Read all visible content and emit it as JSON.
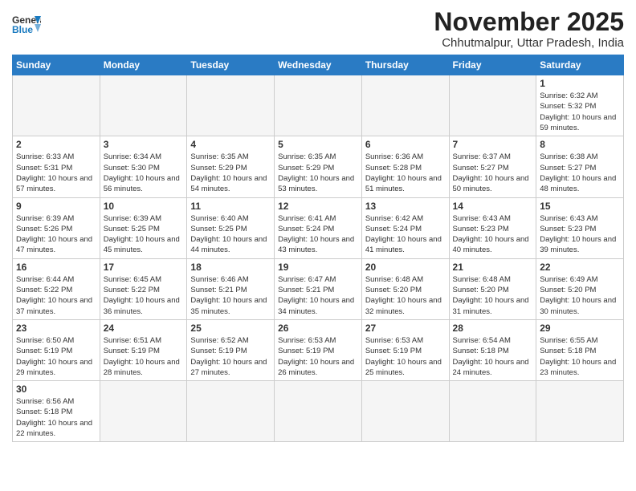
{
  "header": {
    "logo_general": "General",
    "logo_blue": "Blue",
    "month": "November 2025",
    "location": "Chhutmalpur, Uttar Pradesh, India"
  },
  "weekdays": [
    "Sunday",
    "Monday",
    "Tuesday",
    "Wednesday",
    "Thursday",
    "Friday",
    "Saturday"
  ],
  "days": {
    "1": {
      "sunrise": "6:32 AM",
      "sunset": "5:32 PM",
      "daylight": "10 hours and 59 minutes."
    },
    "2": {
      "sunrise": "6:33 AM",
      "sunset": "5:31 PM",
      "daylight": "10 hours and 57 minutes."
    },
    "3": {
      "sunrise": "6:34 AM",
      "sunset": "5:30 PM",
      "daylight": "10 hours and 56 minutes."
    },
    "4": {
      "sunrise": "6:35 AM",
      "sunset": "5:29 PM",
      "daylight": "10 hours and 54 minutes."
    },
    "5": {
      "sunrise": "6:35 AM",
      "sunset": "5:29 PM",
      "daylight": "10 hours and 53 minutes."
    },
    "6": {
      "sunrise": "6:36 AM",
      "sunset": "5:28 PM",
      "daylight": "10 hours and 51 minutes."
    },
    "7": {
      "sunrise": "6:37 AM",
      "sunset": "5:27 PM",
      "daylight": "10 hours and 50 minutes."
    },
    "8": {
      "sunrise": "6:38 AM",
      "sunset": "5:27 PM",
      "daylight": "10 hours and 48 minutes."
    },
    "9": {
      "sunrise": "6:39 AM",
      "sunset": "5:26 PM",
      "daylight": "10 hours and 47 minutes."
    },
    "10": {
      "sunrise": "6:39 AM",
      "sunset": "5:25 PM",
      "daylight": "10 hours and 45 minutes."
    },
    "11": {
      "sunrise": "6:40 AM",
      "sunset": "5:25 PM",
      "daylight": "10 hours and 44 minutes."
    },
    "12": {
      "sunrise": "6:41 AM",
      "sunset": "5:24 PM",
      "daylight": "10 hours and 43 minutes."
    },
    "13": {
      "sunrise": "6:42 AM",
      "sunset": "5:24 PM",
      "daylight": "10 hours and 41 minutes."
    },
    "14": {
      "sunrise": "6:43 AM",
      "sunset": "5:23 PM",
      "daylight": "10 hours and 40 minutes."
    },
    "15": {
      "sunrise": "6:43 AM",
      "sunset": "5:23 PM",
      "daylight": "10 hours and 39 minutes."
    },
    "16": {
      "sunrise": "6:44 AM",
      "sunset": "5:22 PM",
      "daylight": "10 hours and 37 minutes."
    },
    "17": {
      "sunrise": "6:45 AM",
      "sunset": "5:22 PM",
      "daylight": "10 hours and 36 minutes."
    },
    "18": {
      "sunrise": "6:46 AM",
      "sunset": "5:21 PM",
      "daylight": "10 hours and 35 minutes."
    },
    "19": {
      "sunrise": "6:47 AM",
      "sunset": "5:21 PM",
      "daylight": "10 hours and 34 minutes."
    },
    "20": {
      "sunrise": "6:48 AM",
      "sunset": "5:20 PM",
      "daylight": "10 hours and 32 minutes."
    },
    "21": {
      "sunrise": "6:48 AM",
      "sunset": "5:20 PM",
      "daylight": "10 hours and 31 minutes."
    },
    "22": {
      "sunrise": "6:49 AM",
      "sunset": "5:20 PM",
      "daylight": "10 hours and 30 minutes."
    },
    "23": {
      "sunrise": "6:50 AM",
      "sunset": "5:19 PM",
      "daylight": "10 hours and 29 minutes."
    },
    "24": {
      "sunrise": "6:51 AM",
      "sunset": "5:19 PM",
      "daylight": "10 hours and 28 minutes."
    },
    "25": {
      "sunrise": "6:52 AM",
      "sunset": "5:19 PM",
      "daylight": "10 hours and 27 minutes."
    },
    "26": {
      "sunrise": "6:53 AM",
      "sunset": "5:19 PM",
      "daylight": "10 hours and 26 minutes."
    },
    "27": {
      "sunrise": "6:53 AM",
      "sunset": "5:19 PM",
      "daylight": "10 hours and 25 minutes."
    },
    "28": {
      "sunrise": "6:54 AM",
      "sunset": "5:18 PM",
      "daylight": "10 hours and 24 minutes."
    },
    "29": {
      "sunrise": "6:55 AM",
      "sunset": "5:18 PM",
      "daylight": "10 hours and 23 minutes."
    },
    "30": {
      "sunrise": "6:56 AM",
      "sunset": "5:18 PM",
      "daylight": "10 hours and 22 minutes."
    }
  },
  "labels": {
    "sunrise": "Sunrise:",
    "sunset": "Sunset:",
    "daylight": "Daylight:"
  }
}
